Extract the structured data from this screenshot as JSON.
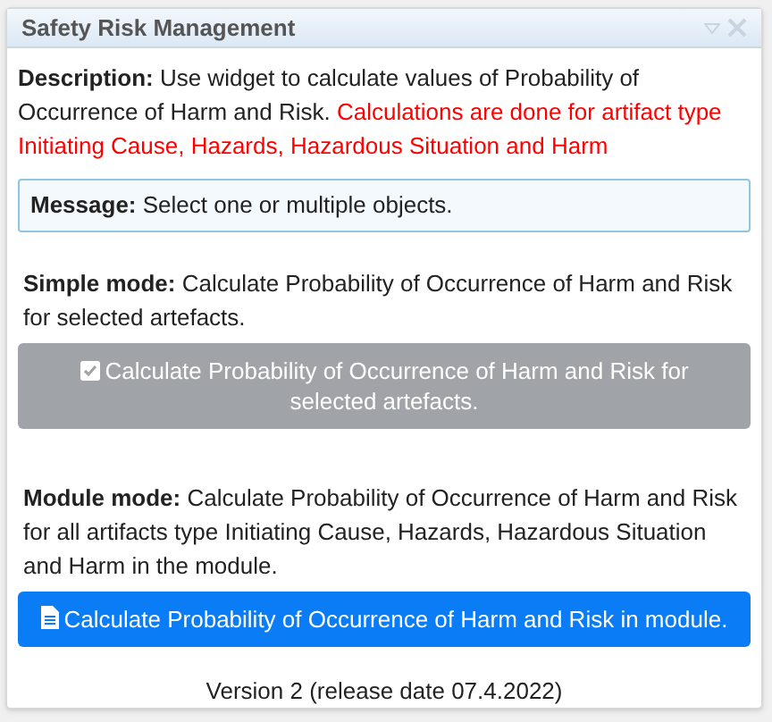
{
  "widget": {
    "title": "Safety Risk Management"
  },
  "description": {
    "text": "**Description:** Use widget to calculate values of Probability of Occurrence of Harm and Risk. ",
    "warning": "Calculations are done for artifact type Initiating Cause, Hazards, Hazardous Situation and Harm"
  },
  "message": {
    "text": "**Message:** Select one or multiple objects."
  },
  "modes": [
    {
      "text": "**Simple mode:** Calculate Probability of Occurrence of Harm and Risk for selected artefacts.",
      "button": "Calculate Probability of Occurrence of Harm and Risk for selected artefacts.",
      "kind": "check",
      "disabled": true
    },
    {
      "text": "**Module mode:** Calculate Probability of Occurrence of Harm and Risk for all artifacts type Initiating Cause, Hazards, Hazardous Situation and Harm in the module.",
      "button": "Calculate Probability of Occurrence of Harm and Risk in module.",
      "kind": "file",
      "disabled": false
    }
  ],
  "version": "Version 2 (release date 07.4.2022)"
}
